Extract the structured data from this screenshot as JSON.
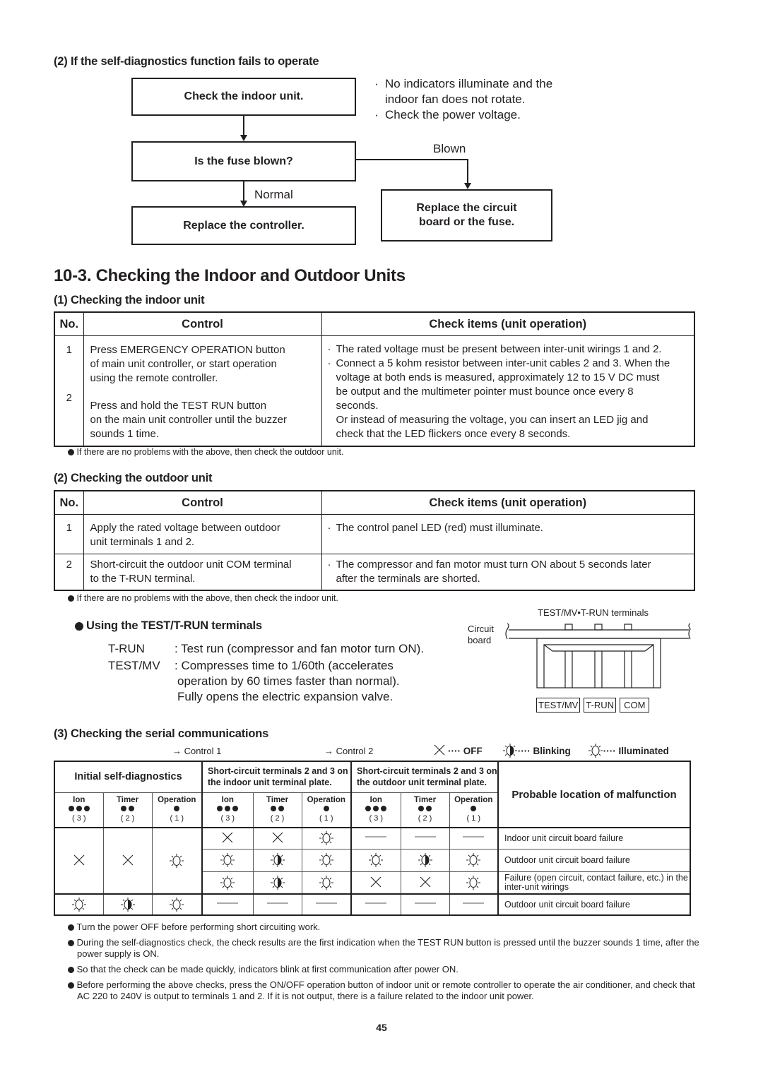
{
  "flowchart": {
    "heading": "(2) If the self-diagnostics function fails to operate",
    "box_check_indoor": "Check the indoor unit.",
    "box_fuse": "Is the fuse blown?",
    "box_replace_controller": "Replace the controller.",
    "box_replace_board": [
      "Replace the circuit",
      "board or the fuse."
    ],
    "label_blown": "Blown",
    "label_normal": "Normal",
    "notes": [
      "No indicators illuminate and the",
      "indoor fan does not rotate.",
      "Check the power voltage."
    ]
  },
  "section": {
    "title": "10-3. Checking the Indoor and Outdoor Units"
  },
  "indoor": {
    "heading": "(1) Checking the indoor unit",
    "columns": [
      "No.",
      "Control",
      "Check items (unit operation)"
    ],
    "nos": [
      "1",
      "2"
    ],
    "control_1": [
      "Press  EMERGENCY OPERATION button",
      "of main unit controller, or start operation",
      "using the remote controller."
    ],
    "control_2": [
      "Press and hold the TEST RUN button",
      "on the main unit controller until the buzzer",
      "sounds 1 time."
    ],
    "checks": [
      "The rated voltage must be present between inter-unit wirings 1 and 2.",
      "Connect a 5 kohm resistor between inter-unit cables 2 and 3. When the",
      "voltage at both ends is measured, approximately 12 to 15 V DC must",
      "be output and the multimeter pointer must bounce once every 8",
      "seconds.",
      "Or instead of measuring the voltage, you can insert an LED jig and",
      "check that the LED flickers once every 8 seconds."
    ],
    "note": "If there are no problems with the above, then check the outdoor unit."
  },
  "outdoor": {
    "heading": "(2) Checking the outdoor unit",
    "columns": [
      "No.",
      "Control",
      "Check items (unit operation)"
    ],
    "rows": [
      {
        "no": "1",
        "control": [
          "Apply the rated voltage between outdoor",
          "unit terminals 1 and 2."
        ],
        "check": [
          "The control panel LED (red) must illuminate."
        ]
      },
      {
        "no": "2",
        "control": [
          "Short-circuit the outdoor unit COM terminal",
          "to the T-RUN terminal."
        ],
        "check": [
          "The compressor and fan motor must turn ON about 5 seconds later",
          "after the terminals are shorted."
        ]
      }
    ],
    "note": "If there are no problems with the above, then check the indoor unit."
  },
  "terminals": {
    "heading": "Using the TEST/T-RUN terminals",
    "trun_key": "T-RUN",
    "trun_desc": ": Test run (compressor and fan motor turn ON).",
    "test_key": "TEST/MV",
    "test_desc": [
      ": Compresses time to 1/60th (accelerates",
      "operation by 60 times faster than normal).",
      "Fully opens the electric expansion valve."
    ],
    "diagram_title": "TEST/MV•T-RUN terminals",
    "diagram_board": [
      "Circuit",
      "board"
    ],
    "diagram_labels": [
      "TEST/MV",
      "T-RUN",
      "COM"
    ]
  },
  "serial": {
    "heading": "(3) Checking the serial communications",
    "control1": "→ Control 1",
    "control2": "→ Control 2",
    "legend": {
      "off": "···· OFF",
      "blinking": "···· Blinking",
      "illuminated": "···· Illuminated"
    },
    "group_headers": [
      "Initial self-diagnostics",
      "Short-circuit terminals 2 and 3 on",
      "the indoor unit terminal plate.",
      "Short-circuit terminals 2 and 3 on",
      "the outdoor unit terminal plate.",
      "Probable location of malfunction"
    ],
    "lamps": [
      {
        "name": "Ion",
        "dots": 3,
        "num": "( 3 )"
      },
      {
        "name": "Timer",
        "dots": 2,
        "num": "( 2 )"
      },
      {
        "name": "Operation",
        "dots": 1,
        "num": "( 1 )"
      }
    ],
    "rows": [
      {
        "initial": [
          "off",
          "off",
          "on"
        ],
        "indoor": [
          "off",
          "off",
          "on"
        ],
        "outdoor": [
          "none",
          "none",
          "none"
        ],
        "location": "Indoor unit circuit board failure"
      },
      {
        "initial": null,
        "indoor": [
          "on",
          "blink",
          "on"
        ],
        "outdoor": [
          "on",
          "blink",
          "on"
        ],
        "location": "Outdoor unit circuit board failure"
      },
      {
        "initial": null,
        "indoor": [
          "on",
          "blink",
          "on"
        ],
        "outdoor": [
          "off",
          "off",
          "on"
        ],
        "location": "Failure (open circuit, contact failure, etc.) in the inter-unit wirings"
      },
      {
        "initial": [
          "on",
          "blink",
          "on"
        ],
        "indoor": [
          "none",
          "none",
          "none"
        ],
        "outdoor": [
          "none",
          "none",
          "none"
        ],
        "location": "Outdoor unit circuit board failure"
      }
    ],
    "notes": [
      "Turn the power OFF before performing short circuiting work.",
      "During the self-diagnostics check, the check results are the first indication when the TEST RUN button is pressed until the buzzer sounds 1 time, after the power supply is ON.",
      "So that the check can be made quickly, indicators blink at first communication after power ON.",
      "Before performing the above checks, press the ON/OFF operation button of indoor unit or remote controller to operate the air conditioner, and check that AC 220 to 240V is output to terminals 1 and 2. If it is not output, there is a failure related to the indoor unit power."
    ]
  },
  "page_number": "45"
}
